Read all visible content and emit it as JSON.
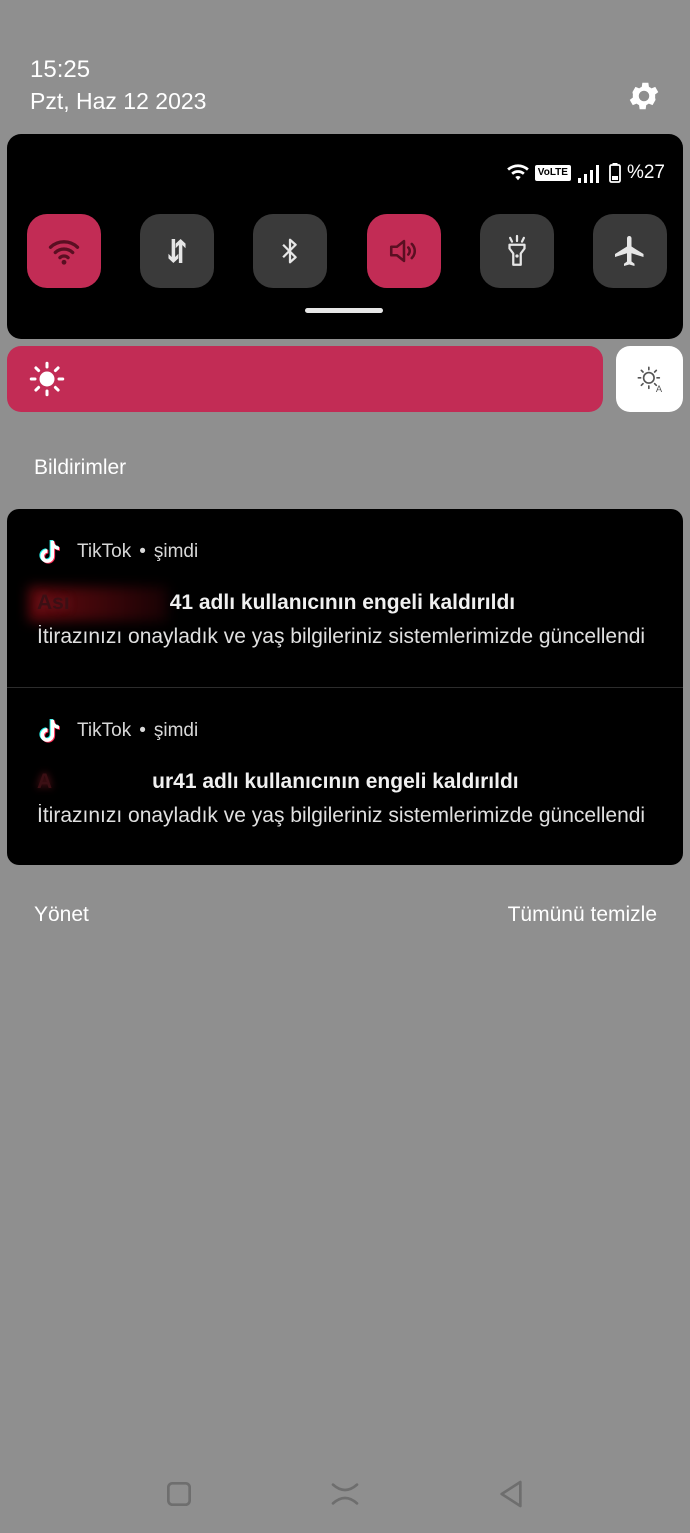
{
  "header": {
    "time": "15:25",
    "date": "Pzt, Haz 12 2023",
    "settings_icon": "gear-icon"
  },
  "status_bar": {
    "wifi_icon": "wifi-icon",
    "volte_label": "VoLTE",
    "signal_icon": "signal-icon",
    "battery_icon": "battery-icon",
    "battery_text": "%27"
  },
  "quick_tiles": [
    {
      "id": "wifi",
      "icon": "wifi-icon",
      "active": true
    },
    {
      "id": "mobile-data",
      "icon": "data-arrows-icon",
      "active": false
    },
    {
      "id": "bluetooth",
      "icon": "bluetooth-icon",
      "active": false
    },
    {
      "id": "sound",
      "icon": "speaker-icon",
      "active": true
    },
    {
      "id": "flashlight",
      "icon": "flashlight-icon",
      "active": false
    },
    {
      "id": "airplane",
      "icon": "airplane-icon",
      "active": false
    }
  ],
  "brightness": {
    "icon": "sun-icon",
    "level": 1.0,
    "auto_icon": "auto-brightness-icon"
  },
  "notifications_title": "Bildirimler",
  "notifications": [
    {
      "app": "TikTok",
      "separator": "•",
      "time": "şimdi",
      "title_redacted": "Ası",
      "title": "41 adlı kullanıcının engeli kaldırıldı",
      "body": "İtirazınızı onayladık ve yaş bilgileriniz sistemlerimizde güncellendi"
    },
    {
      "app": "TikTok",
      "separator": "•",
      "time": "şimdi",
      "title_redacted": "A",
      "title": "ur41 adlı kullanıcının engeli kaldırıldı",
      "body": "İtirazınızı onayladık ve yaş bilgileriniz sistemlerimizde güncellendi"
    }
  ],
  "actions": {
    "manage": "Yönet",
    "clear_all": "Tümünü temizle"
  },
  "colors": {
    "accent": "#c22c55",
    "panel": "#000000",
    "background": "#8f8f8f",
    "tile_off": "#3a3a3a"
  }
}
